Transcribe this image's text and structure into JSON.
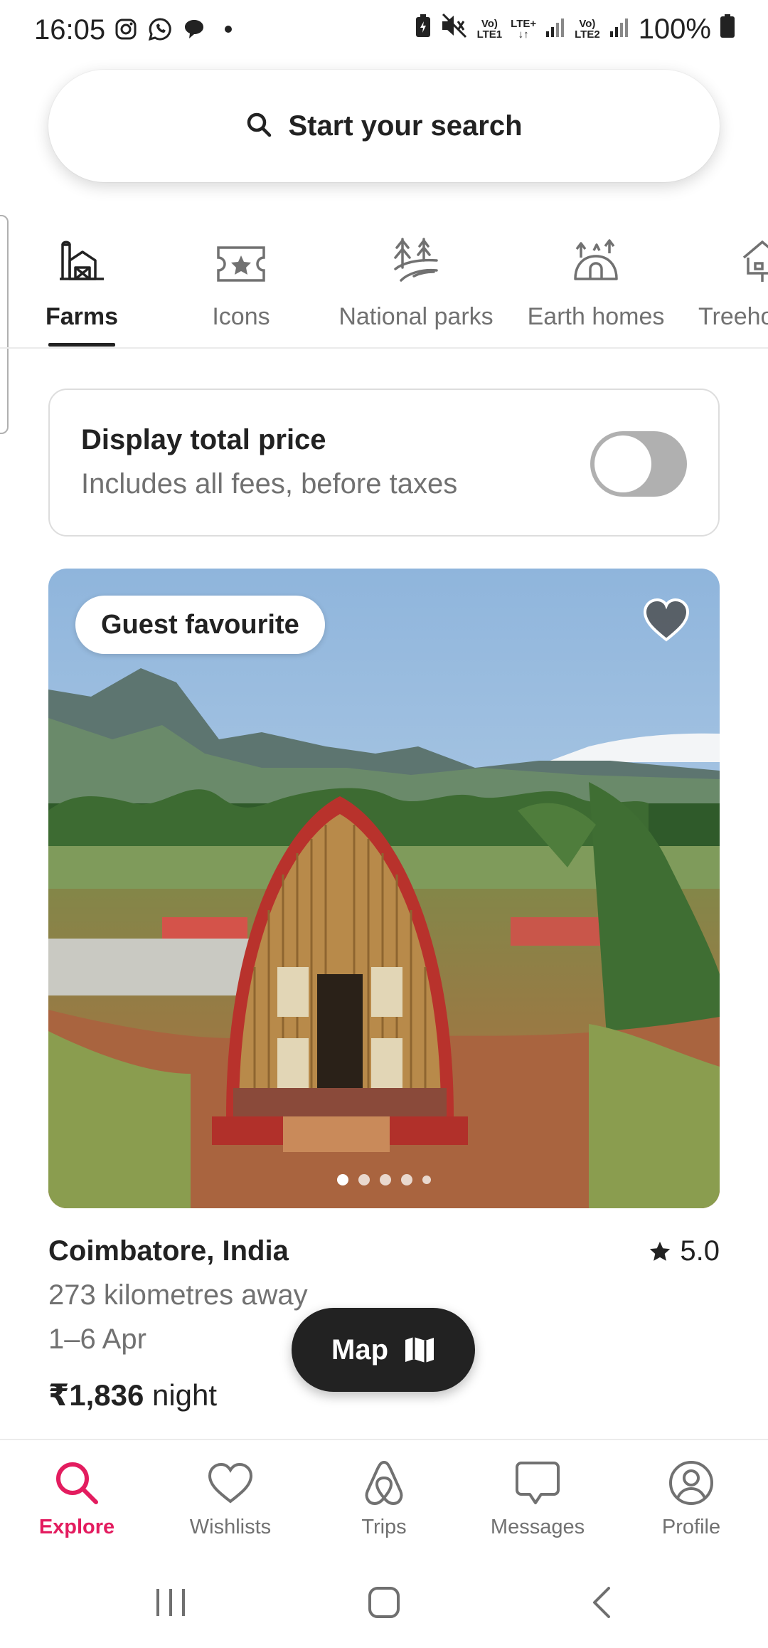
{
  "status_bar": {
    "time": "16:05",
    "battery": "100%",
    "sim1_top": "Vo)",
    "sim1_bottom": "LTE1",
    "lte_label": "LTE+",
    "sim2_top": "Vo)",
    "sim2_bottom": "LTE2"
  },
  "search": {
    "label": "Start your search",
    "icon": "search-icon"
  },
  "categories": [
    {
      "label": "Farms",
      "icon": "farm-icon",
      "active": true
    },
    {
      "label": "Icons",
      "icon": "ticket-star-icon",
      "active": false
    },
    {
      "label": "National parks",
      "icon": "national-park-icon",
      "active": false
    },
    {
      "label": "Earth homes",
      "icon": "earth-home-icon",
      "active": false
    },
    {
      "label": "Treeho",
      "icon": "treehouse-icon",
      "active": false
    }
  ],
  "price_toggle": {
    "title": "Display total price",
    "subtitle": "Includes all fees, before taxes",
    "enabled": false
  },
  "listing": {
    "badge": "Guest favourite",
    "location": "Coimbatore, India",
    "rating": "5.0",
    "distance": "273 kilometres away",
    "dates": "1–6 Apr",
    "price_amount": "₹1,836",
    "price_unit": " night",
    "photo_count": 5,
    "active_photo": 1
  },
  "map_button": {
    "label": "Map"
  },
  "bottom_nav": [
    {
      "label": "Explore",
      "icon": "search-icon",
      "active": true
    },
    {
      "label": "Wishlists",
      "icon": "heart-icon",
      "active": false
    },
    {
      "label": "Trips",
      "icon": "airbnb-logo-icon",
      "active": false
    },
    {
      "label": "Messages",
      "icon": "message-icon",
      "active": false
    },
    {
      "label": "Profile",
      "icon": "profile-icon",
      "active": false
    }
  ],
  "colors": {
    "accent": "#e31c5f",
    "text_primary": "#222222",
    "text_secondary": "#717171",
    "toggle_off": "#b0b0b0"
  }
}
